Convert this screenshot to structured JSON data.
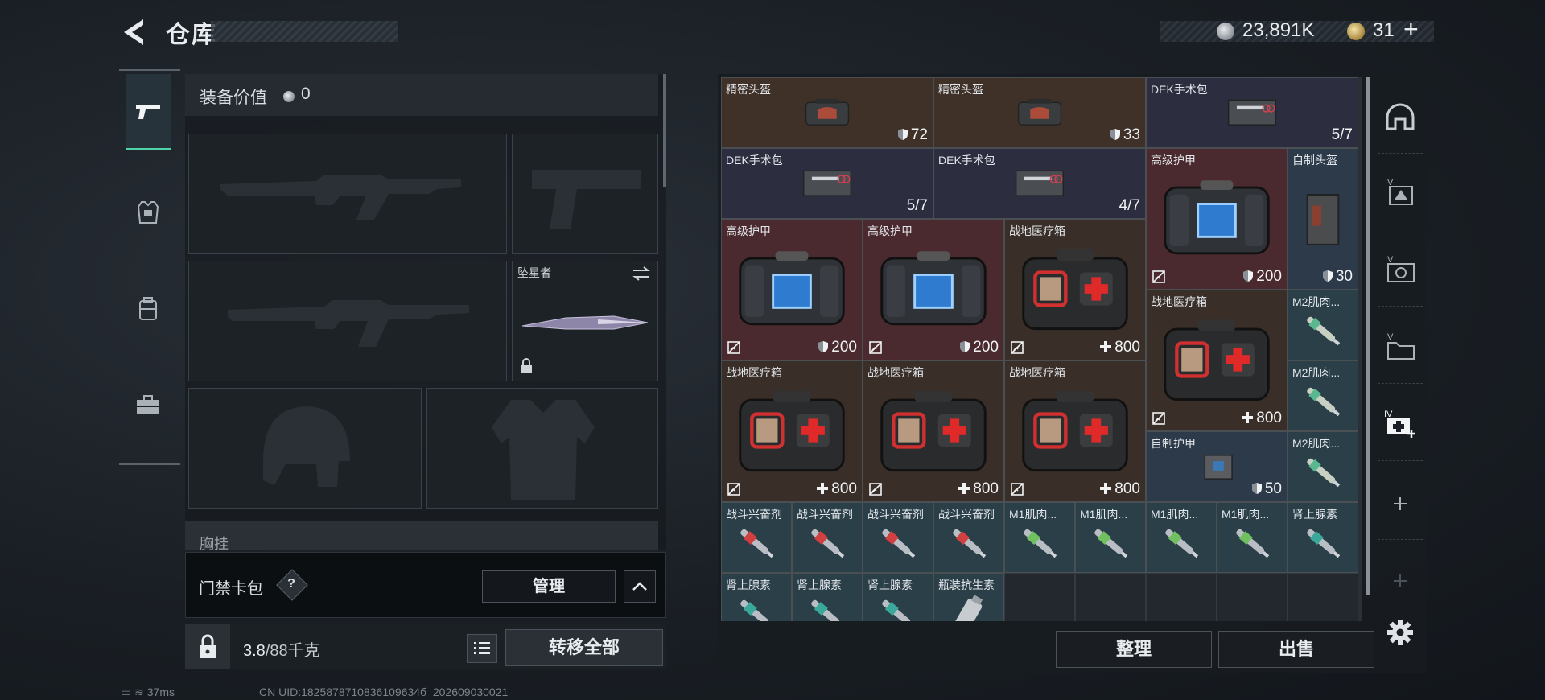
{
  "header": {
    "title": "仓库",
    "silver": "23,891K",
    "gold": "31"
  },
  "loadout": {
    "value_label": "装备价值",
    "value": "0",
    "melee_name": "坠星者",
    "chest_label": "胸挂"
  },
  "keycard": {
    "label": "门禁卡包",
    "help": "?",
    "manage": "管理"
  },
  "bottom": {
    "weight": "3.8",
    "weight_max": "/88千克",
    "transfer_all": "转移全部"
  },
  "stash": {
    "items": [
      {
        "name": "精密头盔",
        "value": "72",
        "icon": "shield"
      },
      {
        "name": "精密头盔",
        "value": "33",
        "icon": "shield"
      },
      {
        "name": "DEK手术包",
        "value": "5/7",
        "icon": ""
      },
      {
        "name": "DEK手术包",
        "value": "5/7",
        "icon": ""
      },
      {
        "name": "DEK手术包",
        "value": "4/7",
        "icon": ""
      },
      {
        "name": "高级护甲",
        "value": "200",
        "icon": "shield"
      },
      {
        "name": "自制头盔",
        "value": "30",
        "icon": "shield"
      },
      {
        "name": "高级护甲",
        "value": "200",
        "icon": "shield"
      },
      {
        "name": "高级护甲",
        "value": "200",
        "icon": "shield"
      },
      {
        "name": "战地医疗箱",
        "value": "800",
        "icon": "plus"
      },
      {
        "name": "战地医疗箱",
        "value": "800",
        "icon": "plus"
      },
      {
        "name": "M2肌肉...",
        "value": "",
        "icon": ""
      },
      {
        "name": "M2肌肉...",
        "value": "",
        "icon": ""
      },
      {
        "name": "战地医疗箱",
        "value": "800",
        "icon": "plus"
      },
      {
        "name": "战地医疗箱",
        "value": "800",
        "icon": "plus"
      },
      {
        "name": "战地医疗箱",
        "value": "800",
        "icon": "plus"
      },
      {
        "name": "自制护甲",
        "value": "50",
        "icon": "shield"
      },
      {
        "name": "M2肌肉...",
        "value": "",
        "icon": ""
      },
      {
        "name": "战斗兴奋剂",
        "value": "",
        "icon": ""
      },
      {
        "name": "战斗兴奋剂",
        "value": "",
        "icon": ""
      },
      {
        "name": "战斗兴奋剂",
        "value": "",
        "icon": ""
      },
      {
        "name": "战斗兴奋剂",
        "value": "",
        "icon": ""
      },
      {
        "name": "M1肌肉...",
        "value": "",
        "icon": ""
      },
      {
        "name": "M1肌肉...",
        "value": "",
        "icon": ""
      },
      {
        "name": "M1肌肉...",
        "value": "",
        "icon": ""
      },
      {
        "name": "M1肌肉...",
        "value": "",
        "icon": ""
      },
      {
        "name": "肾上腺素",
        "value": "",
        "icon": ""
      },
      {
        "name": "肾上腺素",
        "value": "",
        "icon": ""
      },
      {
        "name": "肾上腺素",
        "value": "",
        "icon": ""
      },
      {
        "name": "肾上腺素",
        "value": "",
        "icon": ""
      },
      {
        "name": "瓶装抗生素",
        "value": "",
        "icon": ""
      }
    ],
    "sort": "整理",
    "sell": "出售"
  },
  "status": {
    "ping": "37ms",
    "uid": "CN UID:1825878710836109634б_202609030021"
  }
}
